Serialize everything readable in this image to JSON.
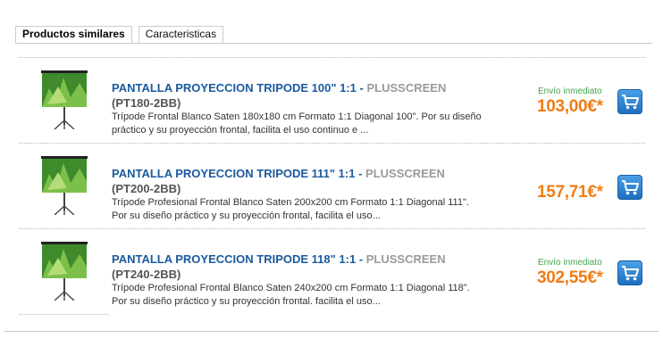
{
  "tabs": {
    "similar_label": "Productos similares",
    "features_label": "Caracteristicas"
  },
  "products": [
    {
      "title": "PANTALLA PROYECCION TRIPODE 100\" 1:1",
      "separator": " - ",
      "brand": "PLUSSCREEN",
      "ref": "(PT180-2BB)",
      "description": "Trípode Frontal Blanco Saten 180x180 cm Formato 1:1 Diagonal 100\". Por su diseño práctico y su proyección frontal, facilita el uso continuo e ...",
      "shipping": "Envío inmediato",
      "price": "103,00€*"
    },
    {
      "title": "PANTALLA PROYECCION TRIPODE 111\" 1:1",
      "separator": " - ",
      "brand": "PLUSSCREEN",
      "ref": "(PT200-2BB)",
      "description": "Trípode Profesional Frontal Blanco Saten 200x200 cm Formato 1:1 Diagonal 111\". Por su diseño práctico y su proyección frontal, facilita el uso...",
      "shipping": "",
      "price": "157,71€*"
    },
    {
      "title": "PANTALLA PROYECCION TRIPODE 118\" 1:1",
      "separator": " - ",
      "brand": "PLUSSCREEN",
      "ref": "(PT240-2BB)",
      "description": "Trípode Profesional Frontal Blanco Saten 240x200 cm Formato 1:1 Diagonal 118\". Por su diseño práctico y su proyección frontal. facilita el uso...",
      "shipping": "Envío inmediato",
      "price": "302,55€*"
    }
  ],
  "icons": {
    "product_image": "projector-screen-image",
    "cart": "shopping-cart-icon"
  },
  "colors": {
    "title": "#1a5a9e",
    "brand": "#9a9a9a",
    "price": "#f07c13",
    "shipping": "#44a54a",
    "cart_button": "#2a82d4"
  }
}
